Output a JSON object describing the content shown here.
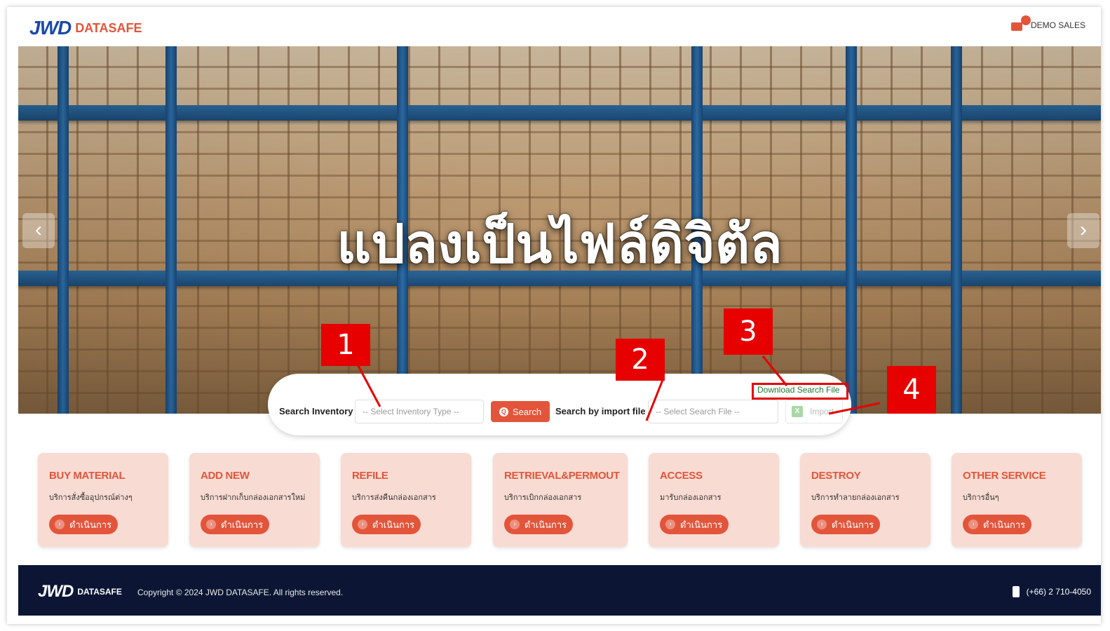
{
  "header": {
    "logo_mark": "JWD",
    "logo_text": "DATASAFE",
    "user_label": "DEMO SALES",
    "cart_icon": "cart-icon"
  },
  "hero": {
    "headline": "แปลงเป็นไฟล์ดิจิตัล",
    "prev_arrow": "‹",
    "next_arrow": "›"
  },
  "search": {
    "inventory_label": "Search Inventory",
    "inventory_placeholder": "-- Select Inventory Type --",
    "search_button": "Search",
    "import_label": "Search by import file",
    "file_placeholder": "-- Select Search File --",
    "download_link": "Download Search File",
    "import_button": "Import"
  },
  "annotations": [
    "1",
    "2",
    "3",
    "4"
  ],
  "cards": [
    {
      "title": "BUY MATERIAL",
      "desc": "บริการสั่งซื้ออุปกรณ์ต่างๆ",
      "button": "ดำเนินการ"
    },
    {
      "title": "ADD NEW",
      "desc": "บริการฝากเก็บกล่องเอกสารใหม่",
      "button": "ดำเนินการ"
    },
    {
      "title": "REFILE",
      "desc": "บริการส่งคืนกล่องเอกสาร",
      "button": "ดำเนินการ"
    },
    {
      "title": "RETRIEVAL&PERMOUT",
      "desc": "บริการเบิกกล่องเอกสาร",
      "button": "ดำเนินการ"
    },
    {
      "title": "ACCESS",
      "desc": "มารับกล่องเอกสาร",
      "button": "ดำเนินการ"
    },
    {
      "title": "DESTROY",
      "desc": "บริการทำลายกล่องเอกสาร",
      "button": "ดำเนินการ"
    },
    {
      "title": "OTHER SERVICE",
      "desc": "บริการอื่นๆ",
      "button": "ดำเนินการ"
    }
  ],
  "footer": {
    "logo_mark": "JWD",
    "logo_text": "DATASAFE",
    "copyright": "Copyright © 2024 JWD DATASAFE. All rights reserved.",
    "phone": "(+66) 2 710-4050"
  },
  "colors": {
    "brand": "#e2553b",
    "brand_blue": "#1a4aa8",
    "card_bg": "#f8dbd2",
    "footer_bg": "#0c1634",
    "annotation_red": "#e60000"
  }
}
